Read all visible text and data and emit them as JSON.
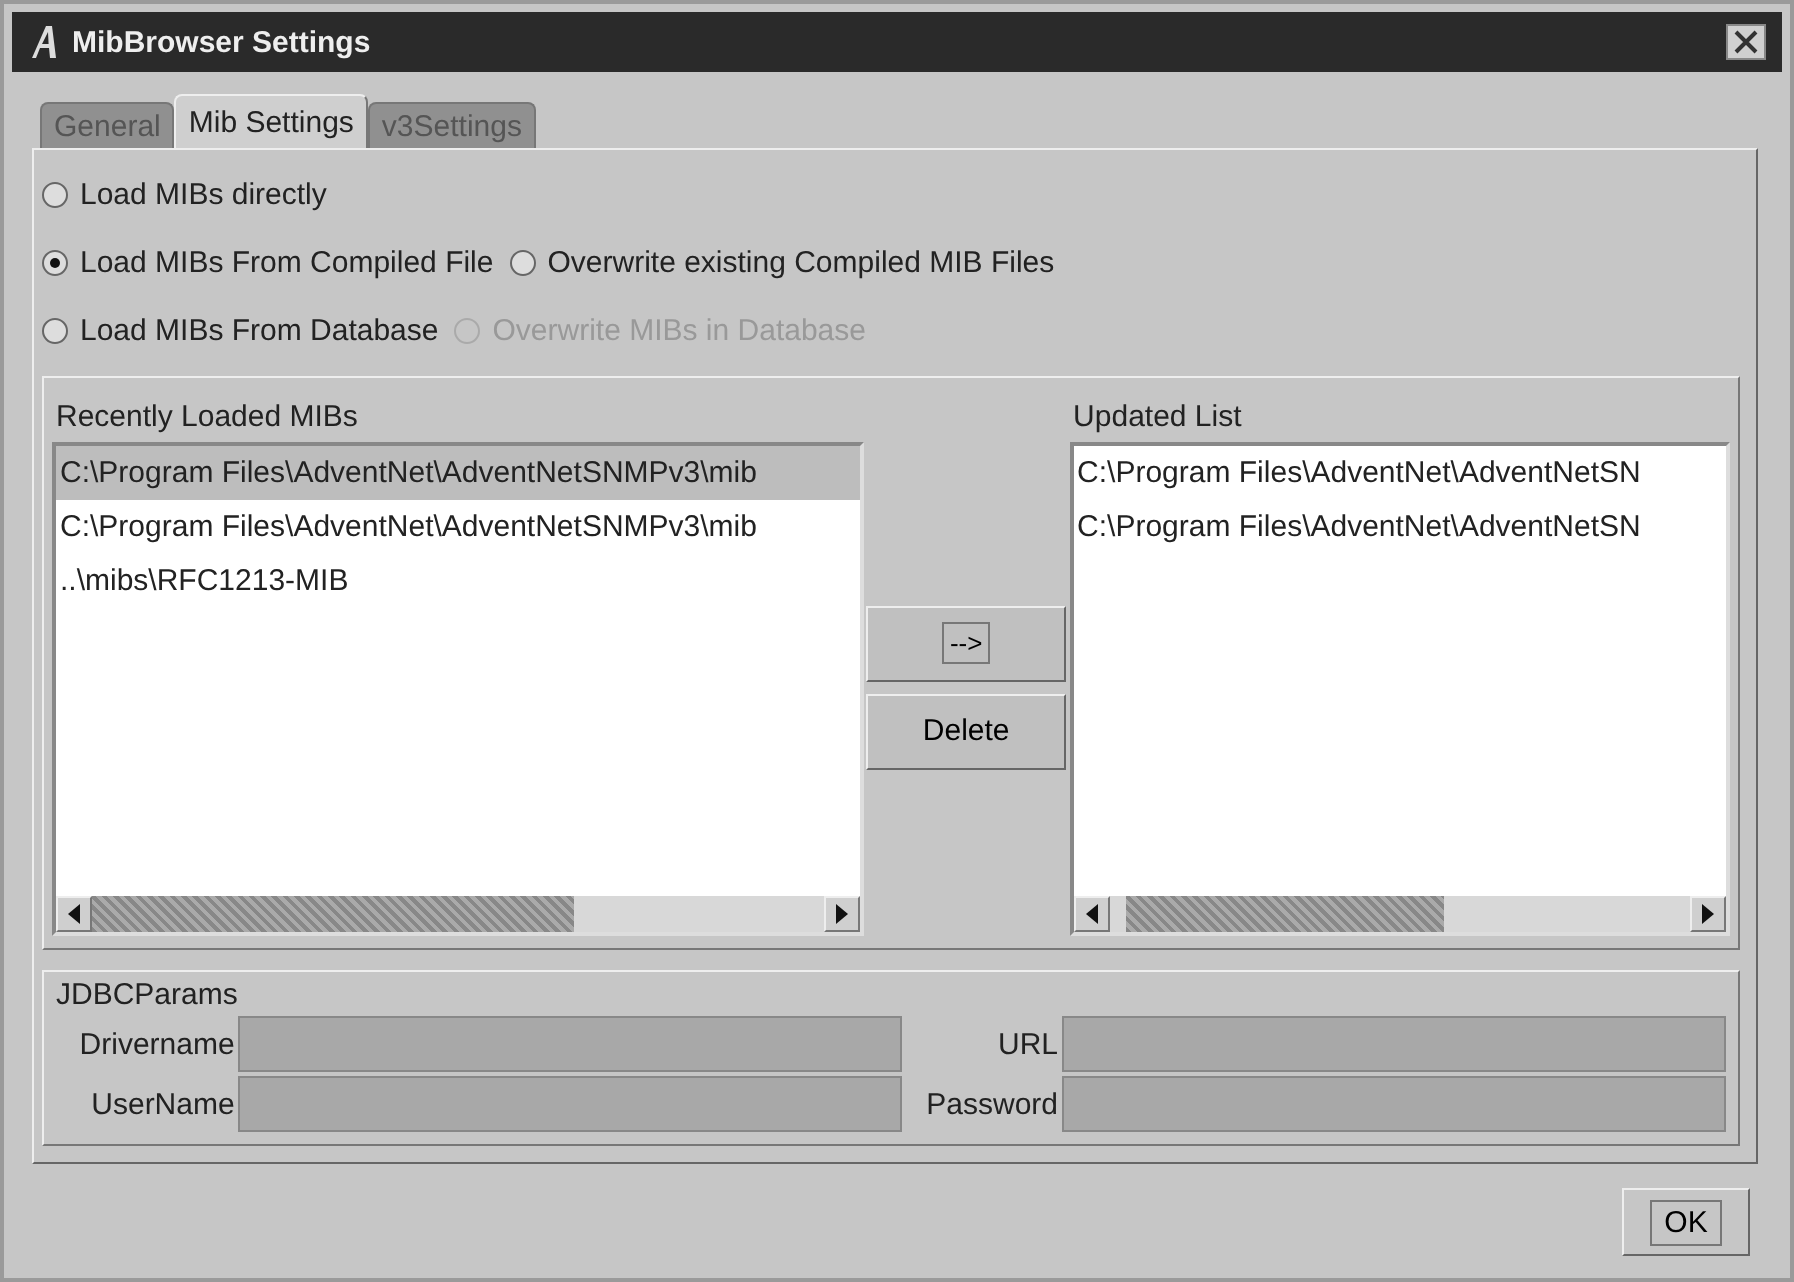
{
  "window": {
    "title": "MibBrowser Settings"
  },
  "tabs": [
    {
      "label": "General",
      "selected": false
    },
    {
      "label": "Mib Settings",
      "selected": true
    },
    {
      "label": "v3Settings",
      "selected": false
    }
  ],
  "radio_rows": [
    [
      {
        "label": "Load MIBs directly",
        "selected": false,
        "disabled": false
      }
    ],
    [
      {
        "label": "Load MIBs From Compiled File",
        "selected": true,
        "disabled": false
      },
      {
        "label": "Overwrite existing Compiled MIB Files",
        "selected": false,
        "disabled": false
      }
    ],
    [
      {
        "label": "Load MIBs From Database",
        "selected": false,
        "disabled": false
      },
      {
        "label": "Overwrite MIBs in Database",
        "selected": false,
        "disabled": true
      }
    ]
  ],
  "recent_list": {
    "label": "Recently Loaded MIBs",
    "items": [
      {
        "text": "C:\\Program Files\\AdventNet\\AdventNetSNMPv3\\mib",
        "selected": true
      },
      {
        "text": "C:\\Program Files\\AdventNet\\AdventNetSNMPv3\\mib",
        "selected": false
      },
      {
        "text": "..\\mibs\\RFC1213-MIB",
        "selected": false
      }
    ]
  },
  "buttons": [
    "-->",
    "Delete"
  ],
  "updated_list": {
    "label": "Updated List",
    "items": [
      {
        "text": "C:\\Program Files\\AdventNet\\AdventNetSN",
        "selected": false
      },
      {
        "text": "C:\\Program Files\\AdventNet\\AdventNetSN",
        "selected": false
      }
    ]
  },
  "jdbc": {
    "title": "JDBCParams",
    "fields": [
      {
        "label": "Drivername",
        "disabled": true
      },
      {
        "label": "URL",
        "disabled": true
      },
      {
        "label": "UserName",
        "disabled": true
      },
      {
        "label": "Password",
        "disabled": true
      }
    ]
  },
  "ok_button": "OK"
}
